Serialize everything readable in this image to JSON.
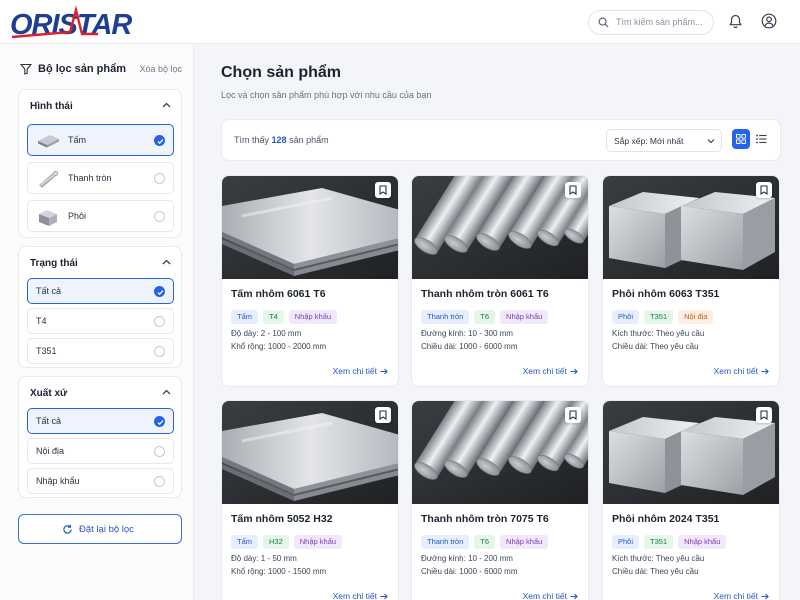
{
  "brand": {
    "logo_text": "ORISTAR",
    "logo_color": "#1c3f94",
    "accent_red": "#e0202a"
  },
  "search": {
    "placeholder": "Tìm kiếm sản phẩm..."
  },
  "header_icons": [
    "bell-icon",
    "user-icon"
  ],
  "sidebar": {
    "title": "Bộ lọc sản phẩm",
    "clear_label": "Xóa bộ lọc",
    "groups": [
      {
        "title": "Hình thái",
        "options": [
          {
            "label": "Tấm",
            "icon": "plate-icon",
            "selected": true
          },
          {
            "label": "Thanh tròn",
            "icon": "round-bar-icon",
            "selected": false
          },
          {
            "label": "Phôi",
            "icon": "billet-icon",
            "selected": false
          }
        ]
      },
      {
        "title": "Trạng thái",
        "options": [
          {
            "label": "Tất cả",
            "selected": true
          },
          {
            "label": "T4",
            "selected": false
          },
          {
            "label": "T351",
            "selected": false
          }
        ]
      },
      {
        "title": "Xuất xứ",
        "options": [
          {
            "label": "Tất cả",
            "selected": true
          },
          {
            "label": "Nội địa",
            "selected": false
          },
          {
            "label": "Nhập khẩu",
            "selected": false
          }
        ]
      }
    ],
    "reset_label": "Đặt lại bộ lọc"
  },
  "main": {
    "title": "Chọn sản phẩm",
    "subtitle": "Lọc và chọn sản phẩm phù hợp với nhu cầu của bạn",
    "result_prefix": "Tìm thấy",
    "result_count": "128",
    "result_suffix": "sản phẩm",
    "sort_label": "Sắp xếp: Mới nhất",
    "view_mode": "grid",
    "accent": "#2563eb"
  },
  "products": [
    {
      "name": "Tấm nhôm 6061 T6",
      "image": "plate",
      "tags": [
        {
          "t": "Tấm",
          "c": "blue"
        },
        {
          "t": "T4",
          "c": "green"
        },
        {
          "t": "Nhập khẩu",
          "c": "purple"
        }
      ],
      "spec1": "Độ dày: 2 - 100 mm",
      "spec2": "Khổ rộng: 1000 - 2000 mm",
      "more": "Xem chi tiết"
    },
    {
      "name": "Thanh nhôm tròn 6061 T6",
      "image": "bar",
      "tags": [
        {
          "t": "Thanh tròn",
          "c": "blue"
        },
        {
          "t": "T6",
          "c": "green"
        },
        {
          "t": "Nhập khẩu",
          "c": "purple"
        }
      ],
      "spec1": "Đường kính: 10 - 300 mm",
      "spec2": "Chiều dài: 1000 - 6000 mm",
      "more": "Xem chi tiết"
    },
    {
      "name": "Phôi nhôm 6063 T351",
      "image": "billet",
      "tags": [
        {
          "t": "Phôi",
          "c": "blue"
        },
        {
          "t": "T351",
          "c": "green"
        },
        {
          "t": "Nội địa",
          "c": "orange"
        }
      ],
      "spec1": "Kích thước: Theo yêu cầu",
      "spec2": "Chiều dài: Theo yêu cầu",
      "more": "Xem chi tiết"
    },
    {
      "name": "Tấm nhôm 5052 H32",
      "image": "plate",
      "tags": [
        {
          "t": "Tấm",
          "c": "blue"
        },
        {
          "t": "H32",
          "c": "green"
        },
        {
          "t": "Nhập khẩu",
          "c": "purple"
        }
      ],
      "spec1": "Độ dày: 1 - 50 mm",
      "spec2": "Khổ rộng: 1000 - 1500 mm",
      "more": "Xem chi tiết"
    },
    {
      "name": "Thanh nhôm tròn 7075 T6",
      "image": "bar",
      "tags": [
        {
          "t": "Thanh tròn",
          "c": "blue"
        },
        {
          "t": "T6",
          "c": "green"
        },
        {
          "t": "Nhập khẩu",
          "c": "purple"
        }
      ],
      "spec1": "Đường kính: 10 - 200 mm",
      "spec2": "Chiều dài: 1000 - 6000 mm",
      "more": "Xem chi tiết"
    },
    {
      "name": "Phôi nhôm 2024 T351",
      "image": "billet",
      "tags": [
        {
          "t": "Phôi",
          "c": "blue"
        },
        {
          "t": "T351",
          "c": "green"
        },
        {
          "t": "Nhập khẩu",
          "c": "purple"
        }
      ],
      "spec1": "Kích thước: Theo yêu cầu",
      "spec2": "Chiều dài: Theo yêu cầu",
      "more": "Xem chi tiết"
    }
  ]
}
